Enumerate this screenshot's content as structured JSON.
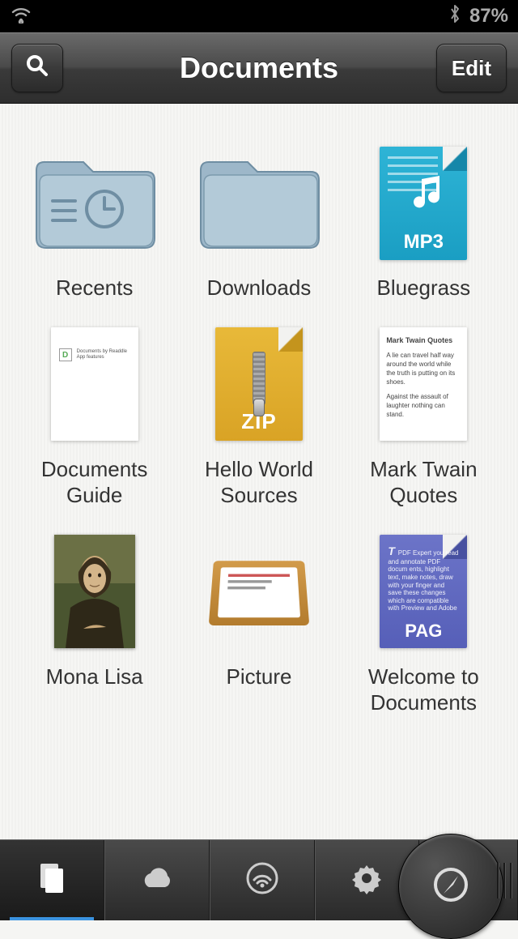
{
  "status": {
    "battery_pct": "87%"
  },
  "nav": {
    "title": "Documents",
    "edit_label": "Edit"
  },
  "items": [
    {
      "label": "Recents",
      "kind": "folder-recents"
    },
    {
      "label": "Downloads",
      "kind": "folder"
    },
    {
      "label": "Bluegrass",
      "kind": "mp3",
      "badge": "MP3"
    },
    {
      "label": "Documents Guide",
      "kind": "guide-doc"
    },
    {
      "label": "Hello World Sources",
      "kind": "zip",
      "badge": "ZIP"
    },
    {
      "label": "Mark Twain Quotes",
      "kind": "quotes-doc",
      "preview": {
        "title": "Mark Twain Quotes",
        "p1": "A lie can travel half way around the world while the truth is putting on its shoes.",
        "p2": "Against the assault of laughter nothing can stand."
      }
    },
    {
      "label": "Mona Lisa",
      "kind": "painting"
    },
    {
      "label": "Picture",
      "kind": "frame"
    },
    {
      "label": "Welcome to Documents",
      "kind": "pag",
      "badge": "PAG",
      "preview_text": "PDF Expert you read and annotate PDF docum ents, highlight text, make notes, draw with your finger and save these changes which are compatible with Preview and Adobe"
    }
  ],
  "tabs": [
    "documents",
    "cloud",
    "wifi",
    "settings",
    "browser"
  ]
}
